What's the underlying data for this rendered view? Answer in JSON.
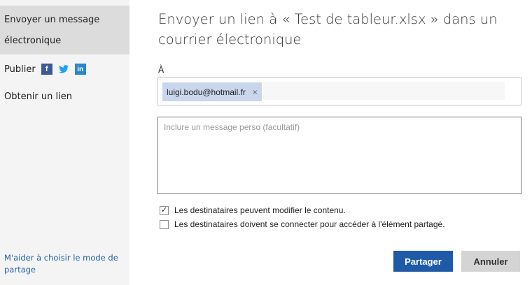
{
  "sidebar": {
    "active_item": {
      "line1": "Envoyer un message",
      "line2": "électronique"
    },
    "publish": {
      "label": "Publier",
      "icons": {
        "facebook": "f",
        "twitter": "🐦",
        "linkedin": "in"
      }
    },
    "obtain_link": "Obtenir un lien",
    "help_link": "M'aider à choisir le mode de partage"
  },
  "main": {
    "title": "Envoyer un lien à « Test de tableur.xlsx » dans un courrier électronique",
    "to_label": "À",
    "recipient": "luigi.bodu@hotmail.fr",
    "recipient_remove": "×",
    "message_placeholder": "Inclure un message perso (facultatif)",
    "options": [
      {
        "label": "Les destinataires peuvent modifier le contenu.",
        "checked": true
      },
      {
        "label": "Les destinataires doivent se connecter pour accéder à l'élément partagé.",
        "checked": false
      }
    ],
    "check_mark": "✓",
    "buttons": {
      "share": "Partager",
      "cancel": "Annuler"
    }
  },
  "colors": {
    "sidebar_bg": "#f4f4f4",
    "active_bg": "#dcdcdc",
    "chip_bg": "#c9d6ec",
    "primary_button": "#1f5aa6",
    "secondary_button": "#d4d4d4",
    "link": "#2563a8"
  }
}
